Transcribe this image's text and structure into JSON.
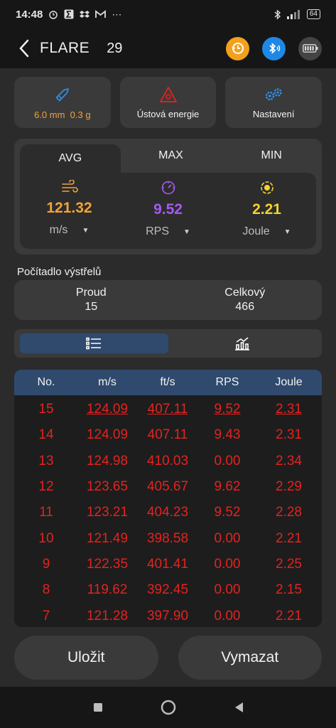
{
  "status": {
    "time": "14:48",
    "battery": "64"
  },
  "header": {
    "title": "FLARE",
    "count": "29"
  },
  "tiles": [
    {
      "label_a": "6.0 mm",
      "label_b": "0.3 g"
    },
    {
      "label": "Ústová energie"
    },
    {
      "label": "Nastavení"
    }
  ],
  "stats": {
    "tabs": [
      "AVG",
      "MAX",
      "MIN"
    ],
    "active_tab": "AVG",
    "velocity": {
      "value": "121.32",
      "unit": "m/s",
      "color": "#f1a33a"
    },
    "rps": {
      "value": "9.52",
      "unit": "RPS",
      "color": "#a25bf0"
    },
    "energy": {
      "value": "2.21",
      "unit": "Joule",
      "color": "#f2d22f"
    }
  },
  "counter": {
    "label": "Počítadlo výstřelů",
    "current_label": "Proud",
    "current_value": "15",
    "total_label": "Celkový",
    "total_value": "466"
  },
  "table": {
    "headers": [
      "No.",
      "m/s",
      "ft/s",
      "RPS",
      "Joule"
    ],
    "rows": [
      [
        "15",
        "124.09",
        "407.11",
        "9.52",
        "2.31"
      ],
      [
        "14",
        "124.09",
        "407.11",
        "9.43",
        "2.31"
      ],
      [
        "13",
        "124.98",
        "410.03",
        "0.00",
        "2.34"
      ],
      [
        "12",
        "123.65",
        "405.67",
        "9.62",
        "2.29"
      ],
      [
        "11",
        "123.21",
        "404.23",
        "9.52",
        "2.28"
      ],
      [
        "10",
        "121.49",
        "398.58",
        "0.00",
        "2.21"
      ],
      [
        "9",
        "122.35",
        "401.41",
        "0.00",
        "2.25"
      ],
      [
        "8",
        "119.62",
        "392.45",
        "0.00",
        "2.15"
      ],
      [
        "7",
        "121.28",
        "397.90",
        "0.00",
        "2.21"
      ]
    ],
    "row_color": "#e32320",
    "header_color": "#2f4a6d"
  },
  "actions": {
    "save": "Uložit",
    "clear": "Vymazat"
  },
  "icons": {
    "history": "history-icon",
    "bluetooth": "bluetooth-icon",
    "battery": "battery-icon"
  }
}
